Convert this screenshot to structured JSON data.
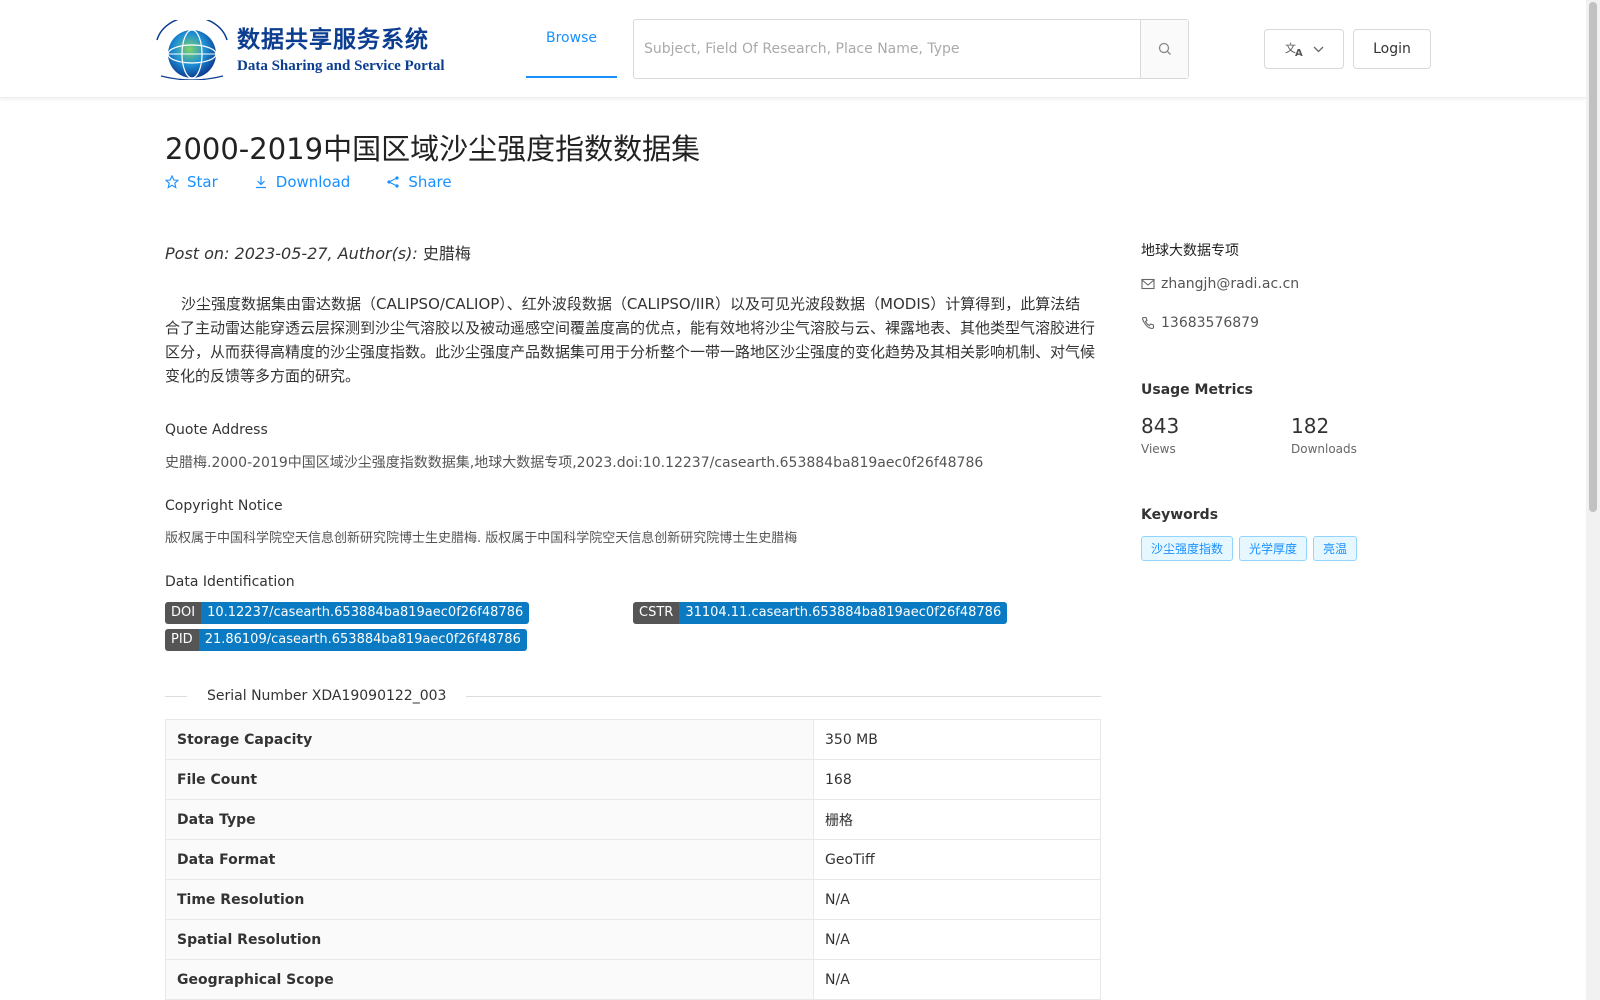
{
  "header": {
    "logo_cn": "数据共享服务系统",
    "logo_en": "Data Sharing and Service Portal",
    "nav_browse": "Browse",
    "search_placeholder": "Subject, Field Of Research, Place Name, Type",
    "login": "Login"
  },
  "dataset": {
    "title": "2000-2019中国区域沙尘强度指数数据集",
    "actions": {
      "star": "Star",
      "download": "Download",
      "share": "Share"
    },
    "post_label": "Post on: 2023-05-27, Author(s): ",
    "author": "史腊梅",
    "description": "沙尘强度数据集由雷达数据（CALIPSO/CALIOP）、红外波段数据（CALIPSO/IIR）以及可见光波段数据（MODIS）计算得到，此算法结合了主动雷达能穿透云层探测到沙尘气溶胶以及被动遥感空间覆盖度高的优点，能有效地将沙尘气溶胶与云、裸露地表、其他类型气溶胶进行区分，从而获得高精度的沙尘强度指数。此沙尘强度产品数据集可用于分析整个一带一路地区沙尘强度的变化趋势及其相关影响机制、对气候变化的反馈等多方面的研究。",
    "quote_label": "Quote Address",
    "quote_text": "史腊梅.2000-2019中国区域沙尘强度指数数据集,地球大数据专项,2023.doi:10.12237/casearth.653884ba819aec0f26f48786",
    "copyright_label": "Copyright Notice",
    "copyright_text": "版权属于中国科学院空天信息创新研究院博士生史腊梅. 版权属于中国科学院空天信息创新研究院博士生史腊梅",
    "identification_label": "Data Identification",
    "ids": {
      "doi_key": "DOI",
      "doi_val": "10.12237/casearth.653884ba819aec0f26f48786",
      "cstr_key": "CSTR",
      "cstr_val": "31104.11.casearth.653884ba819aec0f26f48786",
      "pid_key": "PID",
      "pid_val": "21.86109/casearth.653884ba819aec0f26f48786"
    },
    "serial": "Serial Number XDA19090122_003",
    "meta": [
      {
        "key": "Storage Capacity",
        "value": "350 MB"
      },
      {
        "key": "File Count",
        "value": "168"
      },
      {
        "key": "Data Type",
        "value": "栅格"
      },
      {
        "key": "Data Format",
        "value": "GeoTiff"
      },
      {
        "key": "Time Resolution",
        "value": "N/A"
      },
      {
        "key": "Spatial Resolution",
        "value": "N/A"
      },
      {
        "key": "Geographical Scope",
        "value": "N/A"
      }
    ]
  },
  "sidebar": {
    "org": "地球大数据专项",
    "email": "zhangjh@radi.ac.cn",
    "phone": "13683576879",
    "metrics_title": "Usage Metrics",
    "views": "843",
    "views_label": "Views",
    "downloads": "182",
    "downloads_label": "Downloads",
    "keywords_title": "Keywords",
    "keywords": [
      "沙尘强度指数",
      "光学厚度",
      "亮温"
    ]
  },
  "colors": {
    "accent": "#1890ff",
    "tag_blue": "#0a7ac2",
    "logo_blue": "#0b3d91"
  }
}
